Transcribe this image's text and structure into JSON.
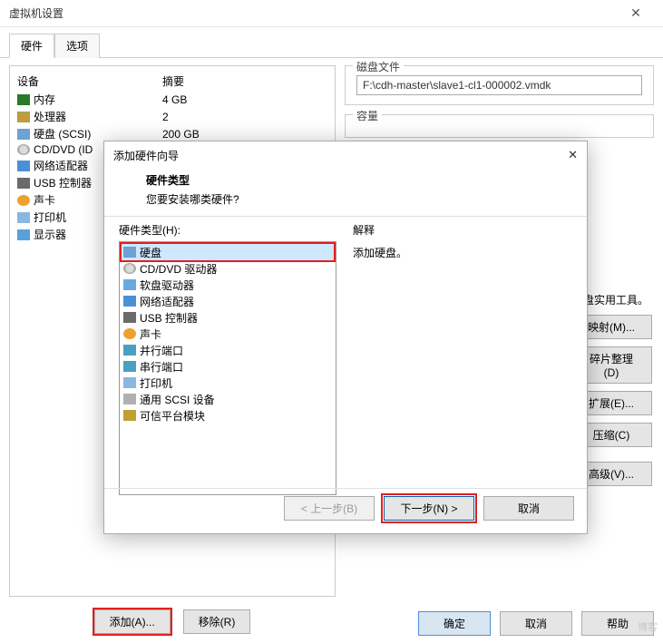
{
  "window_title": "虚拟机设置",
  "tabs": {
    "hardware": "硬件",
    "options": "选项"
  },
  "table": {
    "device_header": "设备",
    "summary_header": "摘要"
  },
  "devices": [
    {
      "name": "内存",
      "summary": "4 GB",
      "icon": "ic-mem"
    },
    {
      "name": "处理器",
      "summary": "2",
      "icon": "ic-cpu"
    },
    {
      "name": "硬盘 (SCSI)",
      "summary": "200 GB",
      "icon": "ic-disk"
    },
    {
      "name": "CD/DVD (ID",
      "summary": "",
      "icon": "ic-cd"
    },
    {
      "name": "网络适配器",
      "summary": "",
      "icon": "ic-net"
    },
    {
      "name": "USB 控制器",
      "summary": "",
      "icon": "ic-usb"
    },
    {
      "name": "声卡",
      "summary": "",
      "icon": "ic-snd"
    },
    {
      "name": "打印机",
      "summary": "",
      "icon": "ic-prn"
    },
    {
      "name": "显示器",
      "summary": "",
      "icon": "ic-mon"
    }
  ],
  "left_buttons": {
    "add": "添加(A)...",
    "remove": "移除(R)"
  },
  "right": {
    "disk_file_group": "磁盘文件",
    "disk_path": "F:\\cdh-master\\slave1-cl1-000002.vmdk",
    "capacity_group": "容量",
    "util_text_tail": "盘实用工具。",
    "btn_map": "映射(M)...",
    "btn_defrag": "碎片整理(D)",
    "btn_expand": "扩展(E)...",
    "btn_compress": "压缩(C)",
    "btn_advanced": "高级(V)..."
  },
  "wizard": {
    "title": "添加硬件向导",
    "heading": "硬件类型",
    "subhead": "您要安装哪类硬件?",
    "list_label": "硬件类型(H):",
    "items": [
      {
        "label": "硬盘",
        "icon": "ic-disk",
        "selected": true
      },
      {
        "label": "CD/DVD 驱动器",
        "icon": "ic-cd"
      },
      {
        "label": "软盘驱动器",
        "icon": "ic-flp"
      },
      {
        "label": "网络适配器",
        "icon": "ic-net"
      },
      {
        "label": "USB 控制器",
        "icon": "ic-usb"
      },
      {
        "label": "声卡",
        "icon": "ic-snd"
      },
      {
        "label": "并行端口",
        "icon": "ic-par"
      },
      {
        "label": "串行端口",
        "icon": "ic-ser"
      },
      {
        "label": "打印机",
        "icon": "ic-prn"
      },
      {
        "label": "通用 SCSI 设备",
        "icon": "ic-scsi"
      },
      {
        "label": "可信平台模块",
        "icon": "ic-tpm"
      }
    ],
    "explain_label": "解释",
    "explain_text": "添加硬盘。",
    "btn_back": "< 上一步(B)",
    "btn_next": "下一步(N) >",
    "btn_cancel": "取消"
  },
  "footer": {
    "ok": "确定",
    "cancel": "取消",
    "help": "帮助"
  },
  "watermark": "博客"
}
